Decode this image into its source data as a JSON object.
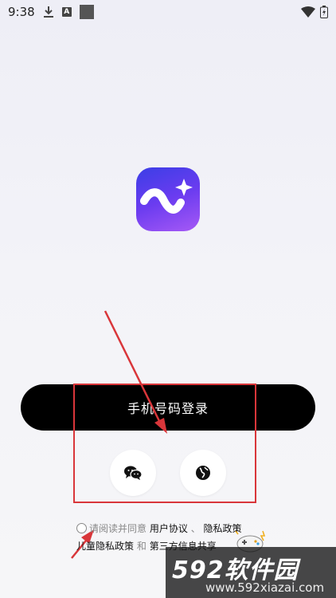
{
  "status_bar": {
    "time": "9:38",
    "icons": [
      "download-icon",
      "text-a-icon",
      "square-icon",
      "wifi-icon",
      "battery-icon"
    ],
    "a_label": "A"
  },
  "app": {
    "logo_icon": "app-logo-wave-sparkle",
    "colors": {
      "logo_start": "#3b3ee6",
      "logo_end": "#a659f5"
    }
  },
  "login": {
    "phone_login_label": "手机号码登录",
    "wechat_icon": "wechat-icon",
    "other_icon": "globe-icon"
  },
  "agreement": {
    "prefix": "请阅读并同意",
    "user_agreement": "用户协议",
    "sep1": "、",
    "privacy_policy": "隐私政策",
    "children_privacy": "儿童隐私政策",
    "and": "和",
    "third_party": "第三方信息共享"
  },
  "watermark": {
    "brand": "592软件园",
    "url": "www.592xiazai.com"
  },
  "annotation_color": "#d9363a"
}
